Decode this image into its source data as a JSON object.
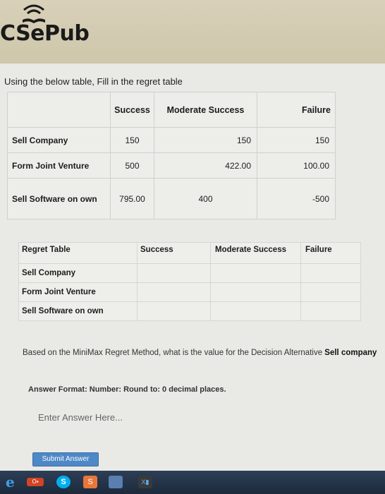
{
  "brand": {
    "name": "CSePub"
  },
  "question": "Using the below table, Fill in the regret table",
  "payoff_table": {
    "columns": [
      "Success",
      "Moderate Success",
      "Failure"
    ],
    "rows": [
      {
        "label": "Sell Company",
        "values": [
          "150",
          "150",
          "150"
        ]
      },
      {
        "label": "Form Joint Venture",
        "values": [
          "500",
          "422.00",
          "100.00"
        ]
      },
      {
        "label": "Sell Software on own",
        "values": [
          "795.00",
          "400",
          "-500"
        ]
      }
    ]
  },
  "regret_table": {
    "title": "Regret Table",
    "columns": [
      "Success",
      "Moderate Success",
      "Failure"
    ],
    "rows": [
      {
        "label": "Sell Company"
      },
      {
        "label": "Form Joint Venture"
      },
      {
        "label": "Sell Software on own"
      }
    ]
  },
  "bottom_question": {
    "prefix": "Based on the MiniMax Regret Method, what is the value for the Decision Alternative",
    "emphasis": "Sell company"
  },
  "answer_format": "Answer Format: Number: Round to: 0 decimal places.",
  "answer": {
    "value": "",
    "placeholder": "Enter Answer Here..."
  },
  "submit_label": "Submit Answer",
  "taskbar": {
    "icons": [
      "internet-explorer-icon",
      "office-icon",
      "skype-icon",
      "app-icon",
      "app-icon",
      "media-icon"
    ],
    "ie_glyph": "e",
    "office_glyph": "O▪",
    "skype_glyph": "S",
    "app3_glyph": "S",
    "app5_glyph": "X▮"
  },
  "colors": {
    "header_bg": "#d8d0b8",
    "submit_bg": "#4f88c6",
    "taskbar_bg": "#2c3e56"
  }
}
